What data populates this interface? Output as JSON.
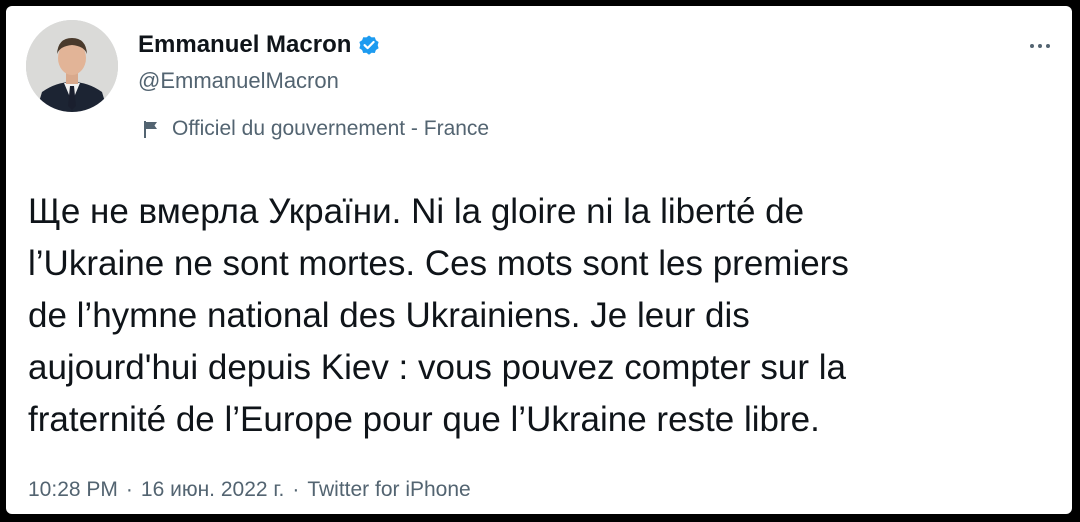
{
  "author": {
    "display_name": "Emmanuel Macron",
    "handle": "@EmmanuelMacron",
    "verified": true,
    "government_label": "Officiel du gouvernement - France"
  },
  "tweet": {
    "lines": [
      "Ще не вмерла України. Ni la gloire ni la liberté de",
      "l’Ukraine ne sont mortes. Ces mots sont les premiers",
      "de l’hymne national des Ukrainiens. Je leur dis",
      "aujourd'hui depuis Kiev : vous pouvez compter sur la",
      "fraternité de l’Europe pour que l’Ukraine reste libre."
    ],
    "time": "10:28 PM",
    "separator": "·",
    "date": "16 июн. 2022 г.",
    "source_separator": "·",
    "source": "Twitter for iPhone"
  },
  "icons": {
    "verified": "verified-badge-icon",
    "government_flag": "flag-icon",
    "more": "more-options-icon"
  },
  "colors": {
    "text_primary": "#0f1419",
    "text_secondary": "#536471",
    "verified_blue": "#1d9bf0",
    "background": "#ffffff",
    "frame": "#000000"
  }
}
